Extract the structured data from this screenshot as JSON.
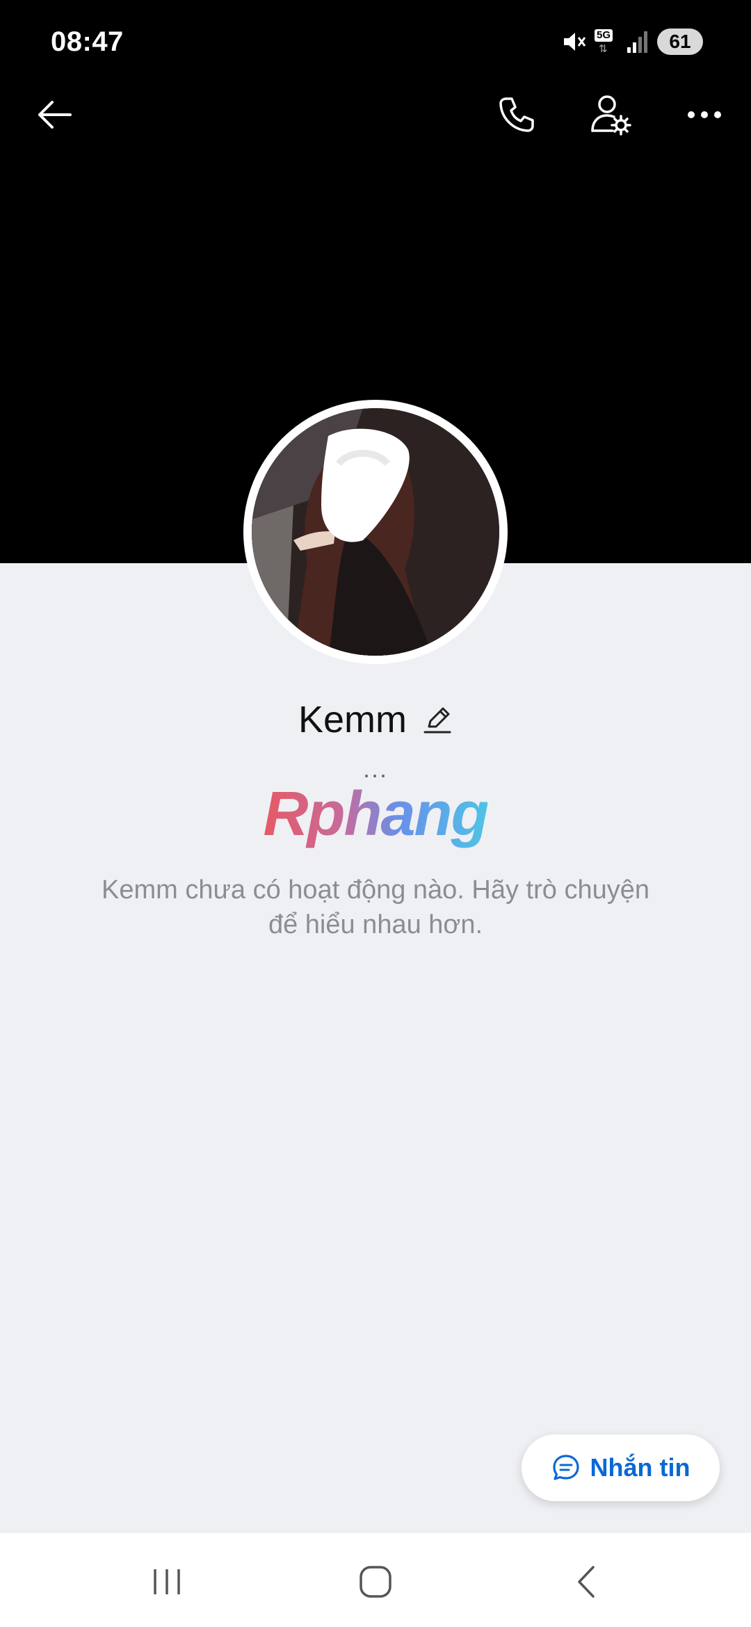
{
  "status_bar": {
    "time": "08:47",
    "network": "5G",
    "battery": "61"
  },
  "top_bar": {
    "icons": [
      "back-arrow-icon",
      "phone-icon",
      "user-settings-icon",
      "more-icon"
    ]
  },
  "profile": {
    "name": "Kemm",
    "bio_placeholder": "...",
    "watermark": "Rphang",
    "empty_message": "Kemm chưa có hoạt động nào. Hãy trò chuyện để hiểu nhau hơn."
  },
  "actions": {
    "message_label": "Nhắn tin"
  },
  "colors": {
    "header_bg": "#000000",
    "page_bg": "#eff0f4",
    "accent": "#0a68d6",
    "muted_text": "#8a8d92"
  }
}
